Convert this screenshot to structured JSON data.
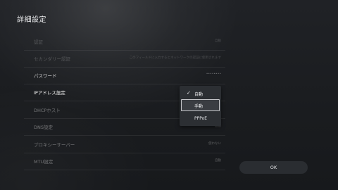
{
  "page": {
    "title": "詳細設定"
  },
  "settings": {
    "rows": [
      {
        "label": "認証",
        "value": "自動"
      },
      {
        "label": "セカンダリー認証",
        "value": "このフィールドに入力するとネットワークの認証に使用されます"
      },
      {
        "label": "パスワード",
        "value": "••••••••"
      },
      {
        "label": "IPアドレス設定",
        "value": ""
      },
      {
        "label": "DHCPホスト",
        "value": ""
      },
      {
        "label": "DNS設定",
        "value": "自動"
      },
      {
        "label": "プロキシーサーバー",
        "value": "使わない"
      },
      {
        "label": "MTU設定",
        "value": "自動"
      }
    ]
  },
  "dropdown": {
    "options": [
      {
        "label": "自動",
        "checked": true
      },
      {
        "label": "手動",
        "focused": true
      },
      {
        "label": "PPPoE"
      }
    ]
  },
  "buttons": {
    "ok_label": "OK"
  }
}
